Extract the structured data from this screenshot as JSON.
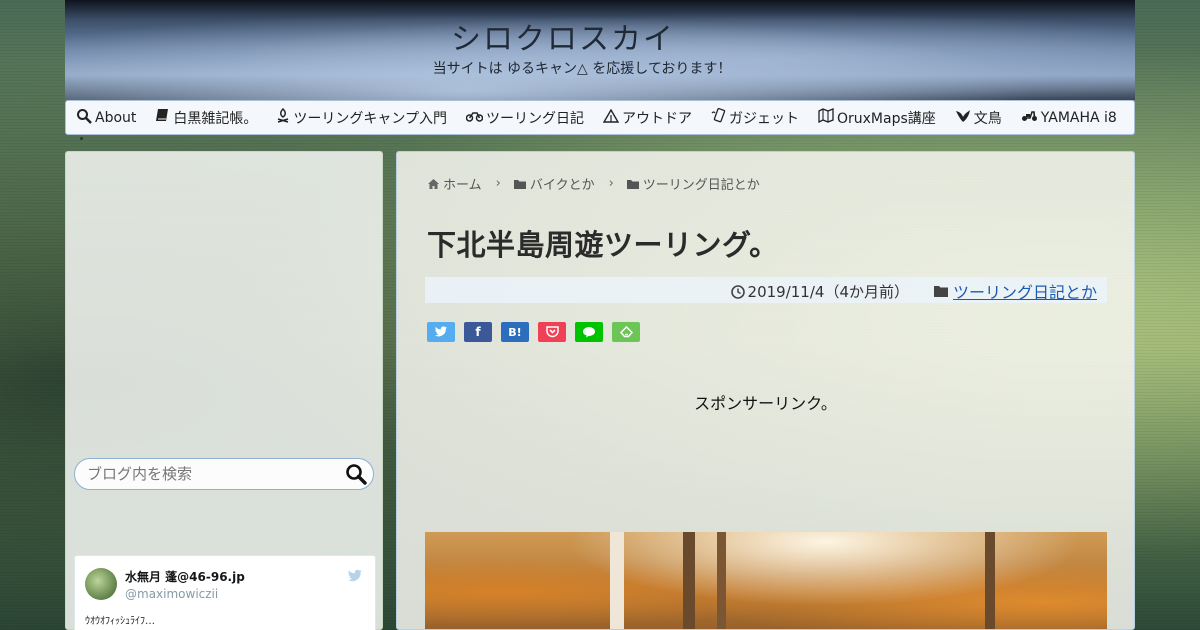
{
  "header": {
    "site_title": "シロクロスカイ",
    "tagline": "当サイトは ゆるキャン△ を応援しております！"
  },
  "nav": {
    "items": [
      {
        "label": "About",
        "icon": "search-icon"
      },
      {
        "label": "白黒雑記帳。",
        "icon": "book-icon"
      },
      {
        "label": "ツーリングキャンプ入門",
        "icon": "campfire-icon"
      },
      {
        "label": "ツーリング日記",
        "icon": "motorcycle-icon"
      },
      {
        "label": "アウトドア",
        "icon": "tent-icon"
      },
      {
        "label": "ガジェット",
        "icon": "gadget-icon"
      },
      {
        "label": "OruxMaps講座",
        "icon": "map-icon"
      },
      {
        "label": "文鳥",
        "icon": "bird-icon"
      },
      {
        "label": "YAMAHA i8",
        "icon": "scooter-icon"
      }
    ]
  },
  "sidebar": {
    "search_placeholder": "ブログ内を検索",
    "tweet": {
      "name": "水無月 蓬@46-96.jp",
      "handle": "@maximowiczii",
      "text": "ｳｵｳｵﾌｨｯｼｭﾗｲﾌ…"
    }
  },
  "breadcrumb": {
    "home": "ホーム",
    "cat1": "バイクとか",
    "cat2": "ツーリング日記とか"
  },
  "post": {
    "title": "下北半島周遊ツーリング。",
    "date": "2019/11/4（4か月前）",
    "category": "ツーリング日記とか",
    "sponsor": "スポンサーリンク。"
  },
  "share": {
    "buttons": [
      {
        "name": "twitter",
        "color": "#55acee",
        "glyph": ""
      },
      {
        "name": "facebook",
        "color": "#3b5998",
        "glyph": "f"
      },
      {
        "name": "hatena",
        "color": "#2c6ebd",
        "glyph": "B!"
      },
      {
        "name": "pocket",
        "color": "#ef4056",
        "glyph": ""
      },
      {
        "name": "line",
        "color": "#00c300",
        "glyph": ""
      },
      {
        "name": "feedly",
        "color": "#6cc655",
        "glyph": ""
      }
    ]
  },
  "colors": {
    "accent_link": "#1a5bb0",
    "nav_border": "#aac0d6"
  }
}
